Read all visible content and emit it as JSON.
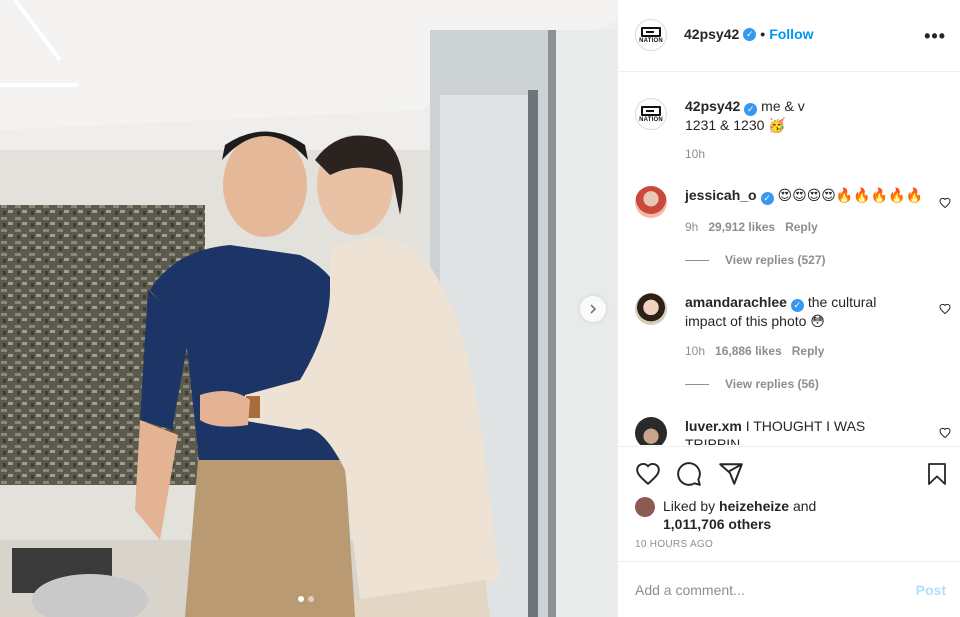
{
  "post": {
    "author": "42psy42",
    "follow_separator": "•",
    "follow_label": "Follow",
    "more_icon": "more-horizontal-icon",
    "avatar_logo_text": "NATION",
    "caption_line1": "me & v",
    "caption_line2": "1231 & 1230 🥳",
    "caption_time": "10h"
  },
  "comments": [
    {
      "user": "jessicah_o",
      "text": "😍😍😍😍🔥🔥🔥🔥🔥",
      "time": "9h",
      "likes": "29,912 likes",
      "reply": "Reply",
      "view_replies": "View replies (527)"
    },
    {
      "user": "amandarachlee",
      "text_line1": "the cultural",
      "text_line2": "impact of this photo 😳",
      "time": "10h",
      "likes": "16,886 likes",
      "reply": "Reply",
      "view_replies": "View replies (56)"
    },
    {
      "user": "luver.xm",
      "text": "I THOUGHT I WAS",
      "text_line2": "TRIPPIN"
    }
  ],
  "actions": {
    "like_icon": "heart-icon",
    "comment_icon": "comment-icon",
    "share_icon": "share-icon",
    "save_icon": "bookmark-icon"
  },
  "likes": {
    "prefix": "Liked by ",
    "user": "heizeheize",
    "and": " and",
    "count": "1,011,706 others"
  },
  "time_ago": "10 HOURS AGO",
  "add_comment": {
    "placeholder": "Add a comment...",
    "post_label": "Post"
  },
  "carousel": {
    "total": 2,
    "current": 1
  },
  "colors": {
    "link_blue": "#0095f6",
    "verified_blue": "#3897f0",
    "post_disabled": "#b2dffc",
    "muted": "#8e8e8e"
  }
}
